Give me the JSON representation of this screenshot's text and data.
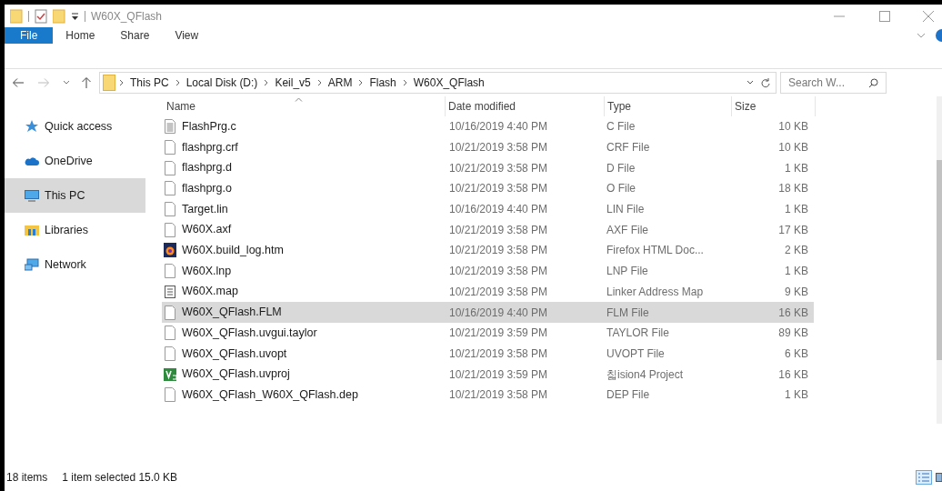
{
  "window": {
    "title": "W60X_QFlash"
  },
  "ribbon_tabs": [
    {
      "label": "File",
      "selected": true
    },
    {
      "label": "Home",
      "selected": false
    },
    {
      "label": "Share",
      "selected": false
    },
    {
      "label": "View",
      "selected": false
    }
  ],
  "breadcrumb": [
    "This PC",
    "Local Disk (D:)",
    "Keil_v5",
    "ARM",
    "Flash",
    "W60X_QFlash"
  ],
  "search": {
    "placeholder": "Search W..."
  },
  "sidebar": {
    "items": [
      {
        "label": "Quick access",
        "kind": "star",
        "selected": false
      },
      {
        "label": "OneDrive",
        "kind": "cloud",
        "selected": false
      },
      {
        "label": "This PC",
        "kind": "pc",
        "selected": true
      },
      {
        "label": "Libraries",
        "kind": "libraries",
        "selected": false
      },
      {
        "label": "Network",
        "kind": "network",
        "selected": false
      }
    ]
  },
  "table": {
    "columns": [
      "Name",
      "Date modified",
      "Type",
      "Size"
    ],
    "rows": [
      {
        "name": "FlashPrg.c",
        "kind": "text",
        "date": "10/16/2019 4:40 PM",
        "type": "C File",
        "size": "10 KB",
        "selected": false
      },
      {
        "name": "flashprg.crf",
        "kind": "blank",
        "date": "10/21/2019 3:58 PM",
        "type": "CRF File",
        "size": "10 KB",
        "selected": false
      },
      {
        "name": "flashprg.d",
        "kind": "blank",
        "date": "10/21/2019 3:58 PM",
        "type": "D File",
        "size": "1 KB",
        "selected": false
      },
      {
        "name": "flashprg.o",
        "kind": "blank",
        "date": "10/21/2019 3:58 PM",
        "type": "O File",
        "size": "18 KB",
        "selected": false
      },
      {
        "name": "Target.lin",
        "kind": "blank",
        "date": "10/16/2019 4:40 PM",
        "type": "LIN File",
        "size": "1 KB",
        "selected": false
      },
      {
        "name": "W60X.axf",
        "kind": "blank",
        "date": "10/21/2019 3:58 PM",
        "type": "AXF File",
        "size": "17 KB",
        "selected": false
      },
      {
        "name": "W60X.build_log.htm",
        "kind": "browser",
        "date": "10/21/2019 3:58 PM",
        "type": "Firefox HTML Doc...",
        "size": "2 KB",
        "selected": false
      },
      {
        "name": "W60X.lnp",
        "kind": "blank",
        "date": "10/21/2019 3:58 PM",
        "type": "LNP File",
        "size": "1 KB",
        "selected": false
      },
      {
        "name": "W60X.map",
        "kind": "doc",
        "date": "10/21/2019 3:58 PM",
        "type": "Linker Address Map",
        "size": "9 KB",
        "selected": false
      },
      {
        "name": "W60X_QFlash.FLM",
        "kind": "blank",
        "date": "10/16/2019 4:40 PM",
        "type": "FLM File",
        "size": "16 KB",
        "selected": true
      },
      {
        "name": "W60X_QFlash.uvgui.taylor",
        "kind": "blank",
        "date": "10/21/2019 3:59 PM",
        "type": "TAYLOR File",
        "size": "89 KB",
        "selected": false
      },
      {
        "name": "W60X_QFlash.uvopt",
        "kind": "blank",
        "date": "10/21/2019 3:58 PM",
        "type": "UVOPT File",
        "size": "6 KB",
        "selected": false
      },
      {
        "name": "W60X_QFlash.uvproj",
        "kind": "project",
        "date": "10/21/2019 3:59 PM",
        "type": "칣ision4 Project",
        "size": "16 KB",
        "selected": false
      },
      {
        "name": "W60X_QFlash_W60X_QFlash.dep",
        "kind": "blank",
        "date": "10/21/2019 3:58 PM",
        "type": "DEP File",
        "size": "1 KB",
        "selected": false
      }
    ]
  },
  "status_bar": {
    "count": "18 items",
    "selection": "1 item selected 15.0 KB"
  }
}
